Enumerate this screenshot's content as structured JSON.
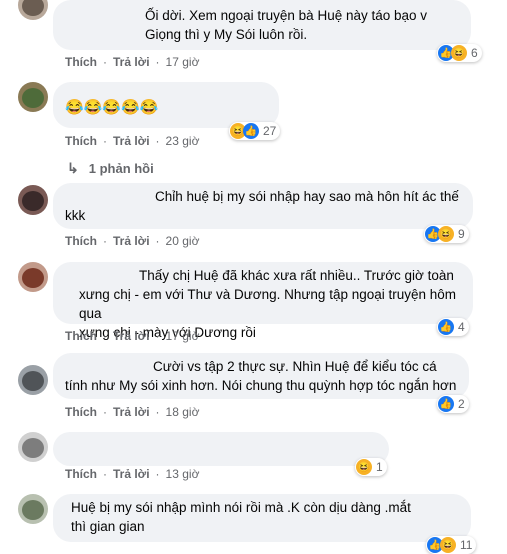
{
  "comments": [
    {
      "text_lines": [
        "Ối dời. Xem ngoại truyện bà Huệ này táo bạo v",
        "Giọng thì y My Sói luôn rồi."
      ],
      "reactions": [
        "like",
        "haha"
      ],
      "count": "6",
      "like_label": "Thích",
      "reply_label": "Trả lời",
      "time": "17 giờ"
    },
    {
      "text_lines": [
        "😂😂😂😂😂"
      ],
      "reactions": [
        "haha",
        "like"
      ],
      "count": "27",
      "like_label": "Thích",
      "reply_label": "Trả lời",
      "time": "23 giờ",
      "replies_label": "1 phản hồi"
    },
    {
      "text_lines": [
        "Chỉh huệ bị my sói nhập hay sao mà hôn hít ác thế",
        "kkk"
      ],
      "reactions": [
        "like",
        "haha"
      ],
      "count": "9",
      "like_label": "Thích",
      "reply_label": "Trả lời",
      "time": "20 giờ"
    },
    {
      "text_lines": [
        "Thấy chị Huệ đã khác xưa rất nhiều.. Trước giờ toàn",
        "xưng chị - em với Thư và Dương. Nhưng tập ngoại truyện hôm qua",
        "xưng chị - mày với Dương rồi"
      ],
      "reactions": [
        "like"
      ],
      "count": "4",
      "like_label": "Thích",
      "reply_label": "Trả lời",
      "time": "17 giờ"
    },
    {
      "text_lines": [
        "Cười vs tập 2 thực sự. Nhìn Huệ để kiểu tóc cá",
        "tính như My sói xinh hơn. Nói chung thu quỳnh hợp tóc ngắn hơn"
      ],
      "reactions": [
        "like"
      ],
      "count": "2",
      "like_label": "Thích",
      "reply_label": "Trả lời",
      "time": "18 giờ"
    },
    {
      "text_lines": [
        ""
      ],
      "reactions": [
        "haha"
      ],
      "count": "1",
      "like_label": "Thích",
      "reply_label": "Trả lời",
      "time": "13 giờ"
    },
    {
      "text_lines": [
        "Huệ bị my sói nhập mình nói rồi mà .K còn dịu dàng .mắt",
        "thì gian gian"
      ],
      "reactions": [
        "like",
        "haha"
      ],
      "count": "11",
      "like_label": "",
      "reply_label": "",
      "time": ""
    }
  ]
}
